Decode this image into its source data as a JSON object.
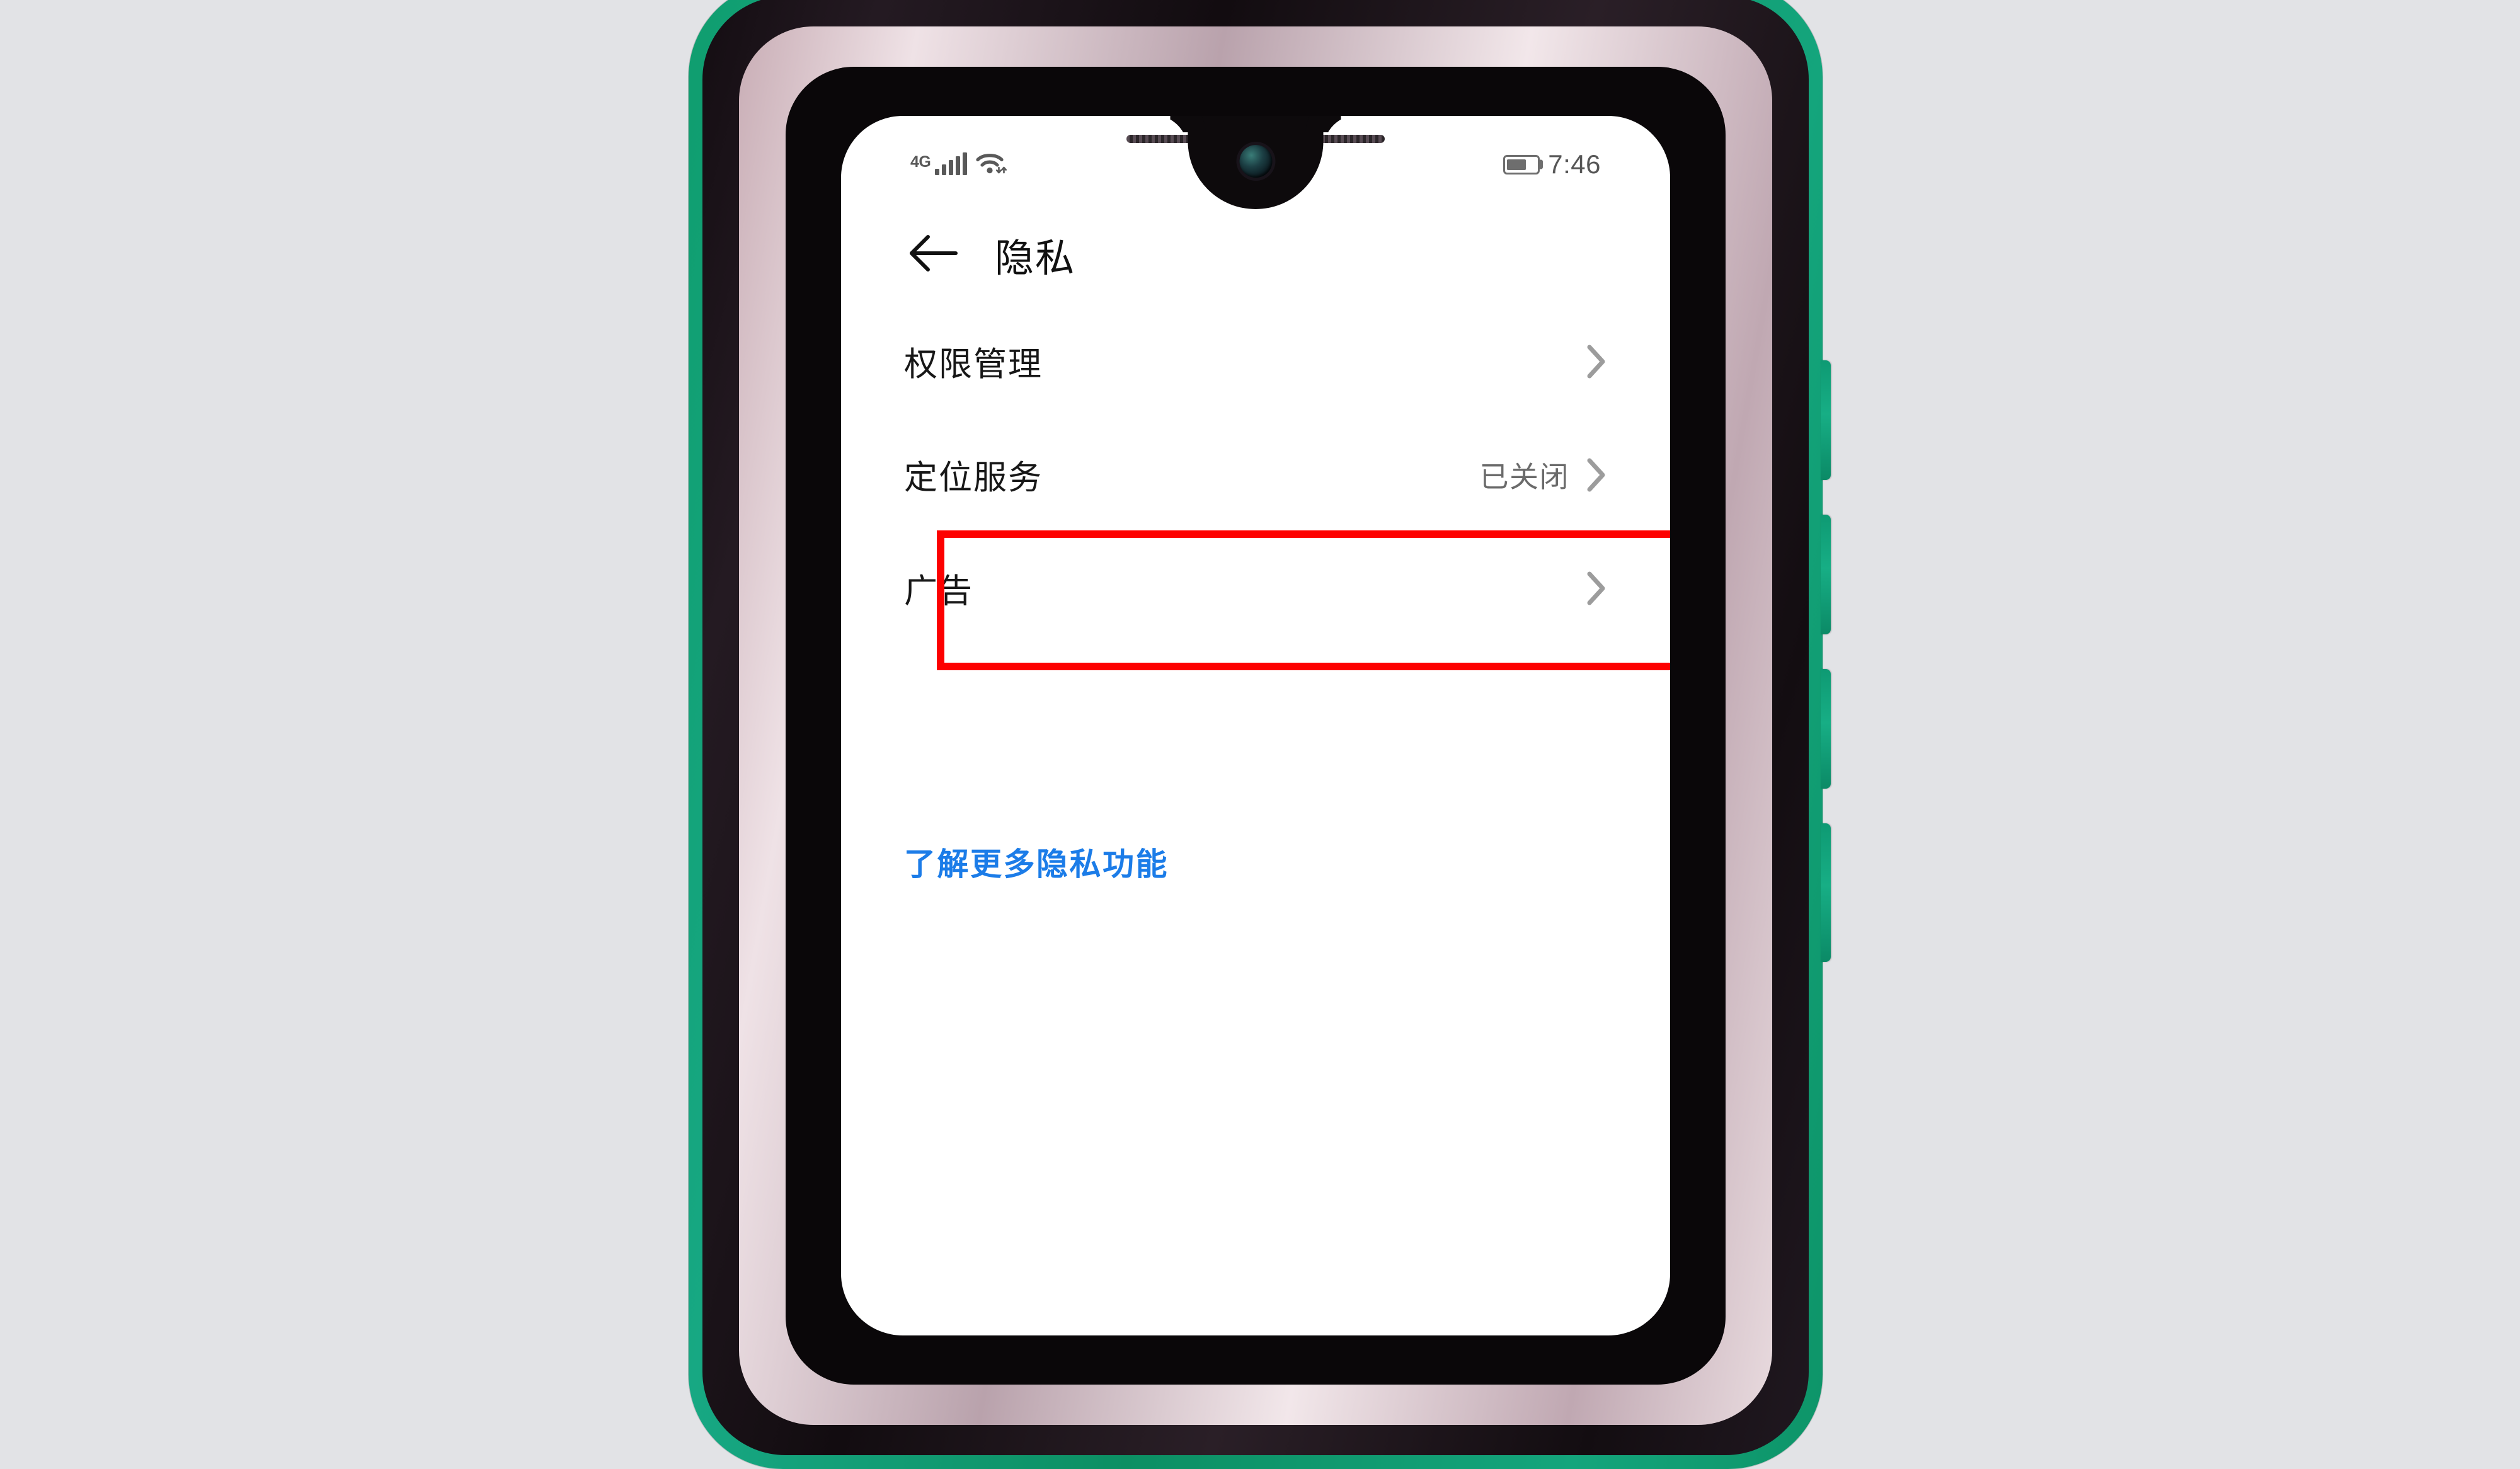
{
  "device": {
    "frame_color": "#12a077",
    "bezel_inner_color": "#e8dade",
    "speaker_name": "earpiece-speaker",
    "camera_name": "front-camera"
  },
  "background_color": "#e2e3e6",
  "status_bar": {
    "network_type": "4G",
    "signal_icon": "signal-bars-icon",
    "signal_bars": 5,
    "wifi_icon": "wifi-icon",
    "battery_icon": "battery-icon",
    "battery_percent": 58,
    "time": "7:46"
  },
  "header": {
    "back_icon": "back-arrow-icon",
    "title": "隐私"
  },
  "settings": {
    "rows": [
      {
        "label": "权限管理",
        "status": "",
        "chevron_icon": "chevron-right-icon",
        "highlighted": false
      },
      {
        "label": "定位服务",
        "status": "已关闭",
        "chevron_icon": "chevron-right-icon",
        "highlighted": true
      },
      {
        "label": "广告",
        "status": "",
        "chevron_icon": "chevron-right-icon",
        "highlighted": false
      }
    ]
  },
  "link": {
    "label": "了解更多隐私功能",
    "color": "#1b7ce8"
  },
  "annotation": {
    "highlight_color": "#fd0100",
    "target_row": "定位服务"
  },
  "colors": {
    "label_text": "#171717",
    "status_text": "#6b6b6b",
    "chevron": "#9c9c9c",
    "status_icon": "#595959"
  }
}
